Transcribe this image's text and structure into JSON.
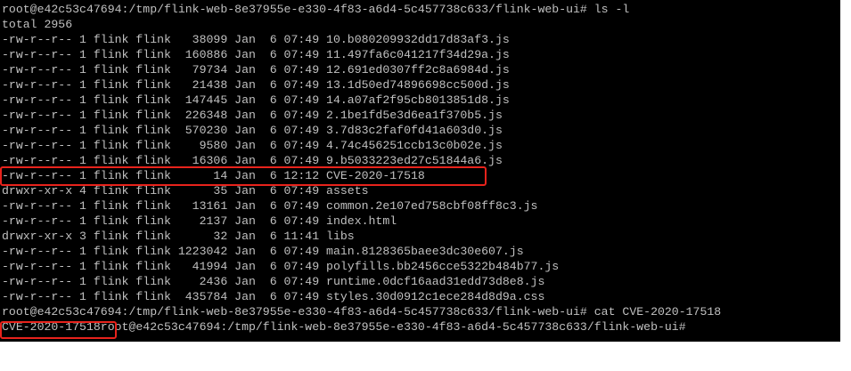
{
  "colors": {
    "terminal_background": "#000000",
    "terminal_text": "#c0c0c0",
    "highlight_box": "#e8231c",
    "page_background": "#ffffff"
  },
  "terminal": {
    "prompt": "root@e42c53c47694:/tmp/flink-web-8e37955e-e330-4f83-a6d4-5c457738c633/flink-web-ui#",
    "lines": [
      "root@e42c53c47694:/tmp/flink-web-8e37955e-e330-4f83-a6d4-5c457738c633/flink-web-ui# ls -l",
      "total 2956",
      "-rw-r--r-- 1 flink flink   38099 Jan  6 07:49 10.b080209932dd17d83af3.js",
      "-rw-r--r-- 1 flink flink  160886 Jan  6 07:49 11.497fa6c041217f34d29a.js",
      "-rw-r--r-- 1 flink flink   79734 Jan  6 07:49 12.691ed0307ff2c8a6984d.js",
      "-rw-r--r-- 1 flink flink   21438 Jan  6 07:49 13.1d50ed74896698cc500d.js",
      "-rw-r--r-- 1 flink flink  147445 Jan  6 07:49 14.a07af2f95cb8013851d8.js",
      "-rw-r--r-- 1 flink flink  226348 Jan  6 07:49 2.1be1fd5e3d6ea1f370b5.js",
      "-rw-r--r-- 1 flink flink  570230 Jan  6 07:49 3.7d83c2faf0fd41a603d0.js",
      "-rw-r--r-- 1 flink flink    9580 Jan  6 07:49 4.74c456251ccb13c0b02e.js",
      "-rw-r--r-- 1 flink flink   16306 Jan  6 07:49 9.b5033223ed27c51844a6.js",
      "-rw-r--r-- 1 flink flink      14 Jan  6 12:12 CVE-2020-17518",
      "drwxr-xr-x 4 flink flink      35 Jan  6 07:49 assets",
      "-rw-r--r-- 1 flink flink   13161 Jan  6 07:49 common.2e107ed758cbf08ff8c3.js",
      "-rw-r--r-- 1 flink flink    2137 Jan  6 07:49 index.html",
      "drwxr-xr-x 3 flink flink      32 Jan  6 11:41 libs",
      "-rw-r--r-- 1 flink flink 1223042 Jan  6 07:49 main.8128365baee3dc30e607.js",
      "-rw-r--r-- 1 flink flink   41994 Jan  6 07:49 polyfills.bb2456cce5322b484b77.js",
      "-rw-r--r-- 1 flink flink    2436 Jan  6 07:49 runtime.0dcf16aad31edd73d8e8.js",
      "-rw-r--r-- 1 flink flink  435784 Jan  6 07:49 styles.30d0912c1ece284d8d9a.css",
      "root@e42c53c47694:/tmp/flink-web-8e37955e-e330-4f83-a6d4-5c457738c633/flink-web-ui# cat CVE-2020-17518",
      "CVE-2020-17518root@e42c53c47694:/tmp/flink-web-8e37955e-e330-4f83-a6d4-5c457738c633/flink-web-ui#"
    ]
  }
}
